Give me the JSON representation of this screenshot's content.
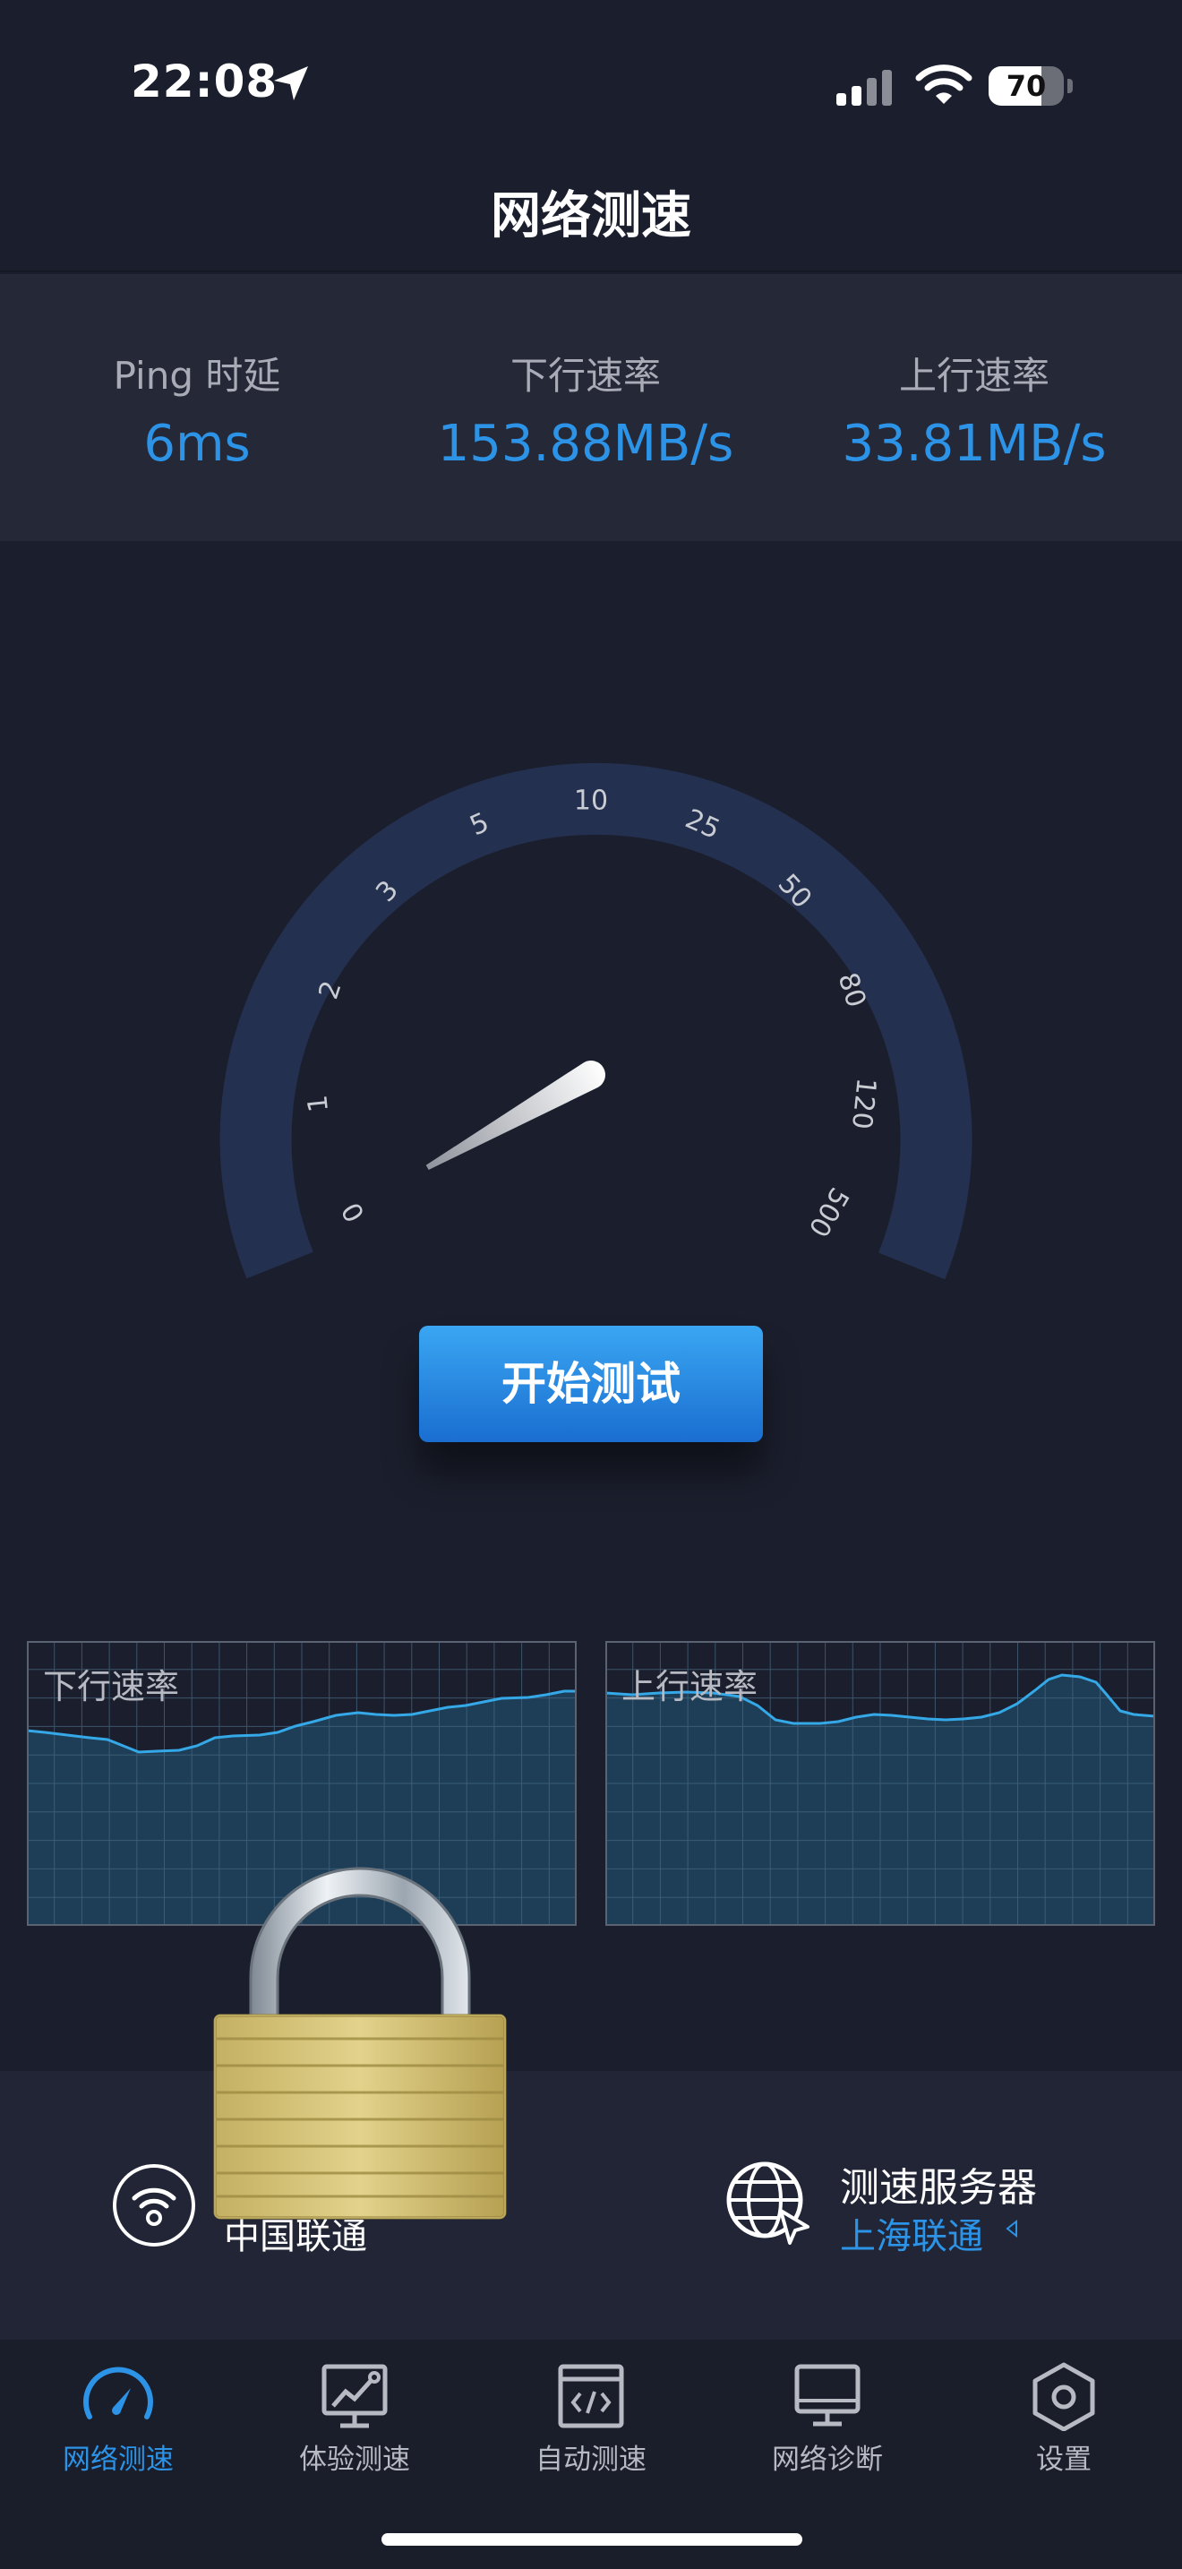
{
  "status_bar": {
    "time": "22:08",
    "battery": "70",
    "battery_level": 0.7
  },
  "header": {
    "title": "网络测速"
  },
  "stats": [
    {
      "label": "Ping 时延",
      "value": "6ms"
    },
    {
      "label": "下行速率",
      "value": "153.88MB/s"
    },
    {
      "label": "上行速率",
      "value": "33.81MB/s"
    }
  ],
  "gauge": {
    "ticks": [
      "0",
      "1",
      "2",
      "3",
      "5",
      "10",
      "25",
      "50",
      "80",
      "120",
      "500"
    ],
    "needle_value": "1"
  },
  "start_button": {
    "label": "开始测试"
  },
  "charts": {
    "download": {
      "label": "下行速率"
    },
    "upload": {
      "label": "上行速率"
    }
  },
  "info": {
    "network_name": "中国联通",
    "server_title": "测速服务器",
    "server_name": "上海联通"
  },
  "tabs": [
    {
      "label": "网络测速",
      "icon": "speedometer-icon",
      "active": true
    },
    {
      "label": "体验测速",
      "icon": "chart-monitor-icon",
      "active": false
    },
    {
      "label": "自动测速",
      "icon": "code-window-icon",
      "active": false
    },
    {
      "label": "网络诊断",
      "icon": "monitor-icon",
      "active": false
    },
    {
      "label": "设置",
      "icon": "settings-hexagon-icon",
      "active": false
    }
  ],
  "colors": {
    "accent": "#2c93e6",
    "background": "#1b1f2d",
    "panel": "#242837",
    "chart_line": "#35a8e8"
  }
}
